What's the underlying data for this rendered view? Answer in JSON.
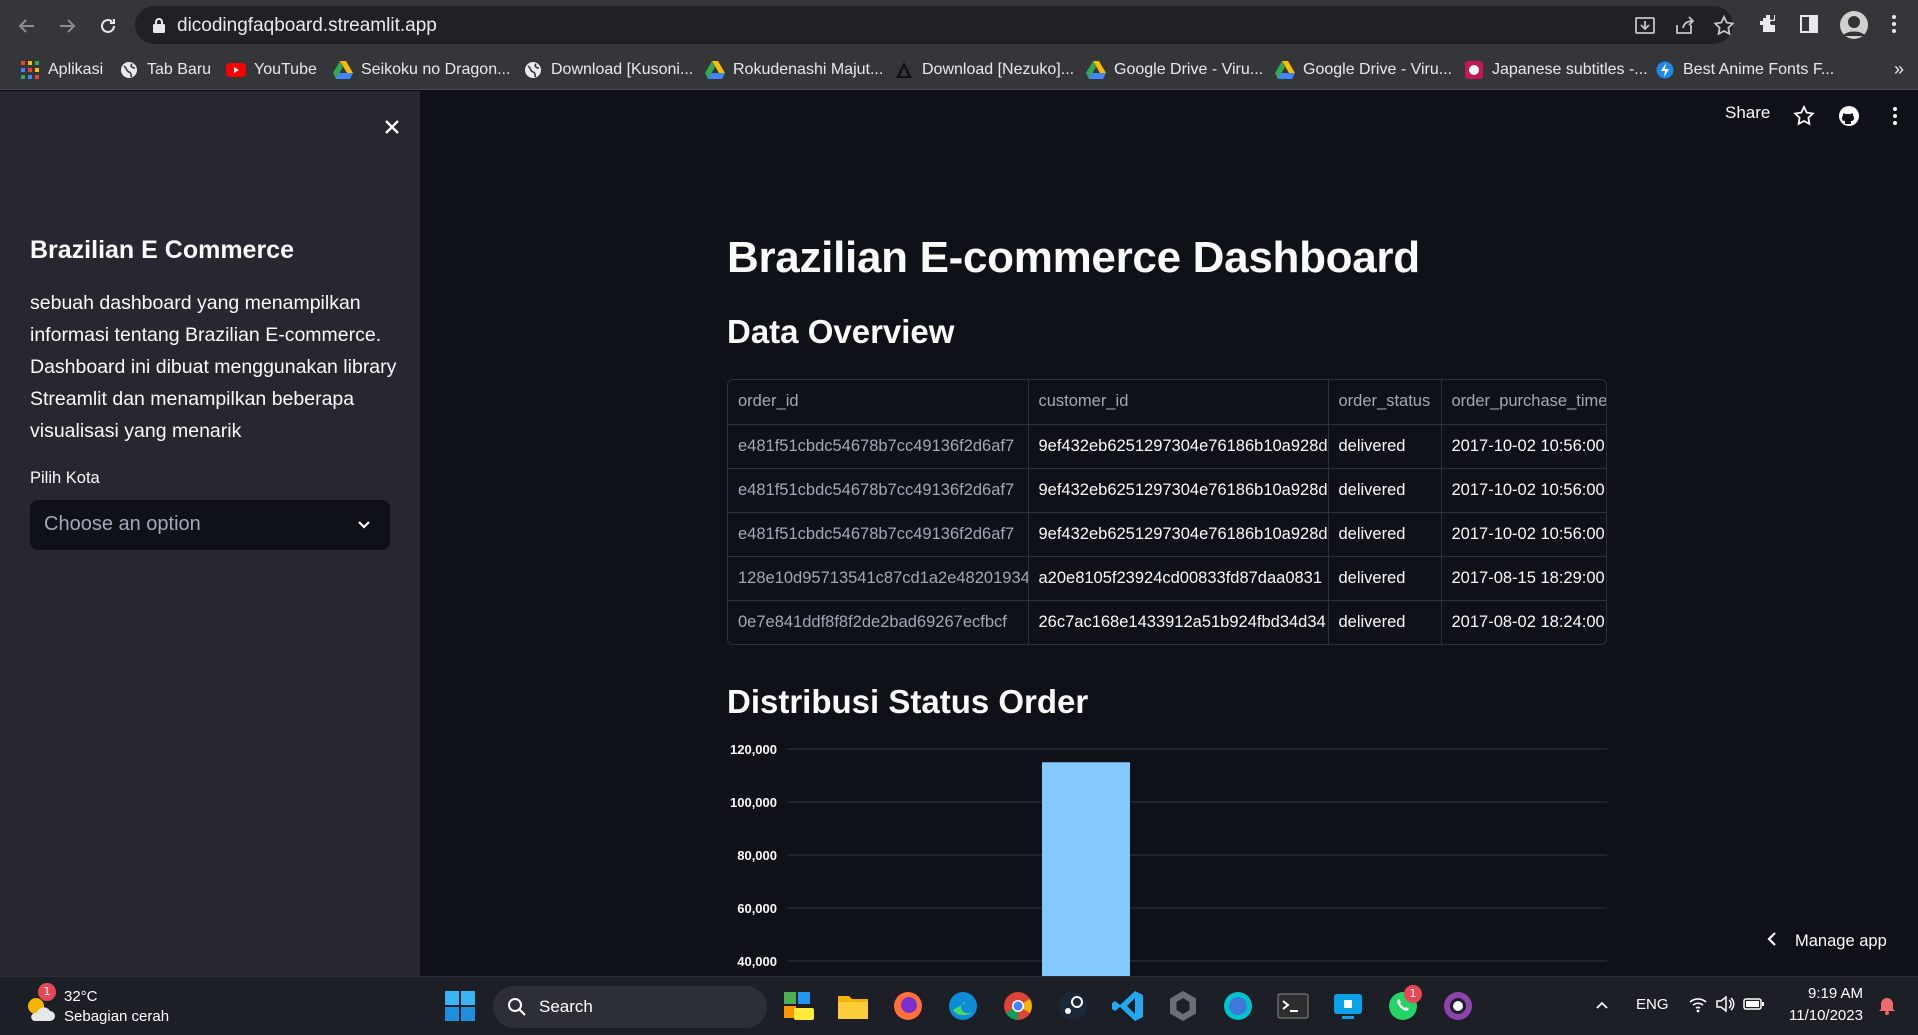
{
  "browser": {
    "url": "dicodingfaqboard.streamlit.app",
    "bookmarks": [
      "Aplikasi",
      "Tab Baru",
      "YouTube",
      "Seikoku no Dragon...",
      "Download [Kusoni...",
      "Rokudenashi Majut...",
      "Download [Nezuko]...",
      "Google Drive - Viru...",
      "Google Drive - Viru...",
      "Japanese subtitles -...",
      "Best Anime Fonts F..."
    ],
    "more_bookmarks": "»"
  },
  "sidebar": {
    "title": "Brazilian E Commerce",
    "description": "sebuah dashboard yang menampilkan informasi tentang Brazilian E-commerce. Dashboard ini dibuat menggunakan library Streamlit dan menampilkan beberapa visualisasi yang menarik",
    "select_label": "Pilih Kota",
    "select_placeholder": "Choose an option"
  },
  "header": {
    "share_label": "Share"
  },
  "main": {
    "title": "Brazilian E-commerce Dashboard",
    "overview_heading": "Data Overview",
    "chart_heading": "Distribusi Status Order",
    "table": {
      "columns": [
        "order_id",
        "customer_id",
        "order_status",
        "order_purchase_time"
      ],
      "rows": [
        [
          "e481f51cbdc54678b7cc49136f2d6af7",
          "9ef432eb6251297304e76186b10a928d",
          "delivered",
          "2017-10-02 10:56:00"
        ],
        [
          "e481f51cbdc54678b7cc49136f2d6af7",
          "9ef432eb6251297304e76186b10a928d",
          "delivered",
          "2017-10-02 10:56:00"
        ],
        [
          "e481f51cbdc54678b7cc49136f2d6af7",
          "9ef432eb6251297304e76186b10a928d",
          "delivered",
          "2017-10-02 10:56:00"
        ],
        [
          "128e10d95713541c87cd1a2e48201934",
          "a20e8105f23924cd00833fd87daa0831",
          "delivered",
          "2017-08-15 18:29:00"
        ],
        [
          "0e7e841ddf8f8f2de2bad69267ecfbcf",
          "26c7ac168e1433912a51b924fbd34d34",
          "delivered",
          "2017-08-02 18:24:00"
        ]
      ]
    },
    "manage_app_label": "Manage app"
  },
  "chart_data": {
    "type": "bar",
    "title": "",
    "categories": [
      ""
    ],
    "series": [
      {
        "values": [
          115000
        ]
      }
    ],
    "ylim": [
      40000,
      120000
    ],
    "yticks": [
      120000,
      100000,
      80000,
      60000,
      40000
    ],
    "ytick_labels": [
      "120,000",
      "100,000",
      "80,000",
      "60,000",
      "40,000"
    ],
    "grid": true,
    "bar_color": "#83c9ff",
    "note": ""
  },
  "taskbar": {
    "weather_temp": "32°C",
    "weather_desc": "Sebagian cerah",
    "weather_badge": "1",
    "search_label": "Search",
    "language": "ENG",
    "time": "9:19 AM",
    "date": "11/10/2023",
    "whatsapp_badge": "1"
  },
  "colors": {
    "app_bg": "#0e1117",
    "sidebar_bg": "#262730",
    "chrome_bg": "#35363a",
    "taskbar_bg": "#1c1f26",
    "bar": "#83c9ff"
  }
}
